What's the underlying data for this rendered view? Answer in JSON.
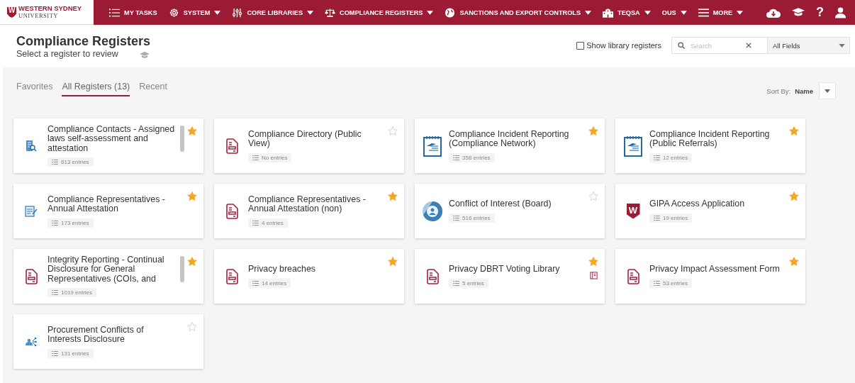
{
  "logo": {
    "line1": "WESTERN SYDNEY",
    "line2": "UNIVERSITY",
    "mark": "W"
  },
  "nav": [
    {
      "label": "MY TASKS",
      "kind": "list",
      "caret": false
    },
    {
      "label": "SYSTEM",
      "kind": "gear",
      "caret": true
    },
    {
      "label": "CORE LIBRARIES",
      "kind": "sliders",
      "caret": true
    },
    {
      "label": "COMPLIANCE REGISTERS",
      "kind": "scales",
      "caret": true
    },
    {
      "label": "SANCTIONS AND EXPORT CONTROLS",
      "kind": "globe",
      "caret": true
    },
    {
      "label": "TEQSA",
      "kind": "building",
      "caret": true
    },
    {
      "label": "OUS",
      "kind": "plain",
      "caret": true
    },
    {
      "label": "MORE",
      "kind": "menu",
      "caret": true
    }
  ],
  "nav_actions": [
    {
      "kind": "cloud"
    },
    {
      "kind": "cap"
    },
    {
      "kind": "help",
      "label": "?"
    },
    {
      "kind": "user"
    }
  ],
  "header": {
    "title": "Compliance Registers",
    "subtitle": "Select a register to review",
    "show_library": {
      "label": "Show library registers",
      "checked": false
    },
    "search": {
      "placeholder": "Search"
    },
    "field_filter": "All Fields"
  },
  "tabs": [
    {
      "label": "Favorites",
      "selected": false
    },
    {
      "label": "All Registers (13)",
      "selected": true
    },
    {
      "label": "Recent",
      "selected": false
    }
  ],
  "sort": {
    "label": "Sort By:",
    "value": "Name"
  },
  "registers": [
    {
      "title": "Compliance Contacts - Assigned laws self-assessment and attestation",
      "entries": "613 entries",
      "kind": "building-search",
      "favorite": true,
      "overflow": true,
      "library": false
    },
    {
      "title": "Compliance Directory (Public View)",
      "entries": "No entries",
      "kind": "form",
      "favorite": false,
      "overflow": false,
      "library": false
    },
    {
      "title": "Compliance Incident Reporting (Compliance Network)",
      "entries": "358 entries",
      "kind": "notepad",
      "favorite": true,
      "overflow": false,
      "library": false
    },
    {
      "title": "Compliance Incident Reporting (Public Referrals)",
      "entries": "12 entries",
      "kind": "notepad",
      "favorite": true,
      "overflow": false,
      "library": false
    },
    {
      "title": "Compliance Representatives - Annual Attestation",
      "entries": "173 entries",
      "kind": "notes-pen",
      "favorite": true,
      "overflow": false,
      "library": false
    },
    {
      "title": "Compliance Representatives - Annual Attestation (non)",
      "entries": "4 entries",
      "kind": "form",
      "favorite": true,
      "overflow": false,
      "library": false
    },
    {
      "title": "Conflict of Interest (Board)",
      "entries": "516 entries",
      "kind": "person-circle",
      "favorite": false,
      "overflow": false,
      "library": false
    },
    {
      "title": "GIPA Access Application",
      "entries": "19 entries",
      "kind": "shield",
      "icon_letter": "W",
      "favorite": true,
      "overflow": false,
      "library": false
    },
    {
      "title": "Integrity Reporting - Continual Disclosure for General Representatives (COIs, and",
      "entries": "1019 entries",
      "kind": "form",
      "favorite": true,
      "overflow": true,
      "library": false
    },
    {
      "title": "Privacy breaches",
      "entries": "14 entries",
      "kind": "form",
      "favorite": true,
      "overflow": false,
      "library": false
    },
    {
      "title": "Privacy DBRT Voting Library",
      "entries": "5 entries",
      "kind": "form",
      "favorite": true,
      "overflow": false,
      "library": true
    },
    {
      "title": "Privacy Impact Assessment Form",
      "entries": "53 entries",
      "kind": "form",
      "favorite": true,
      "overflow": false,
      "library": false
    },
    {
      "title": "Procurement Conflicts of Interests Disclosure",
      "entries": "131 entries",
      "kind": "people-network",
      "favorite": false,
      "overflow": false,
      "library": false
    }
  ]
}
